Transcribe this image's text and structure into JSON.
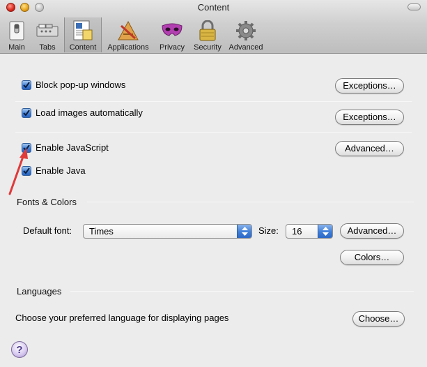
{
  "window": {
    "title": "Content"
  },
  "toolbar": {
    "items": [
      {
        "label": "Main",
        "icon": "switch-icon"
      },
      {
        "label": "Tabs",
        "icon": "tabs-icon"
      },
      {
        "label": "Content",
        "icon": "content-page-icon",
        "selected": true
      },
      {
        "label": "Applications",
        "icon": "applications-icon"
      },
      {
        "label": "Privacy",
        "icon": "mask-icon"
      },
      {
        "label": "Security",
        "icon": "padlock-icon"
      },
      {
        "label": "Advanced",
        "icon": "gear-icon"
      }
    ]
  },
  "options": {
    "block_popups": {
      "label": "Block pop-up windows",
      "checked": true,
      "button": "Exceptions…"
    },
    "load_images": {
      "label": "Load images automatically",
      "checked": true,
      "button": "Exceptions…"
    },
    "enable_js": {
      "label": "Enable JavaScript",
      "checked": true,
      "button": "Advanced…"
    },
    "enable_java": {
      "label": "Enable Java",
      "checked": true
    }
  },
  "fonts": {
    "heading": "Fonts & Colors",
    "default_font_label": "Default font:",
    "default_font_value": "Times",
    "size_label": "Size:",
    "size_value": "16",
    "advanced_button": "Advanced…",
    "colors_button": "Colors…"
  },
  "languages": {
    "heading": "Languages",
    "description": "Choose your preferred language for displaying pages",
    "choose_button": "Choose…"
  },
  "help": {
    "glyph": "?"
  },
  "colors": {
    "accent": "#3f7fd6",
    "annotation_arrow": "#e03a3a"
  }
}
